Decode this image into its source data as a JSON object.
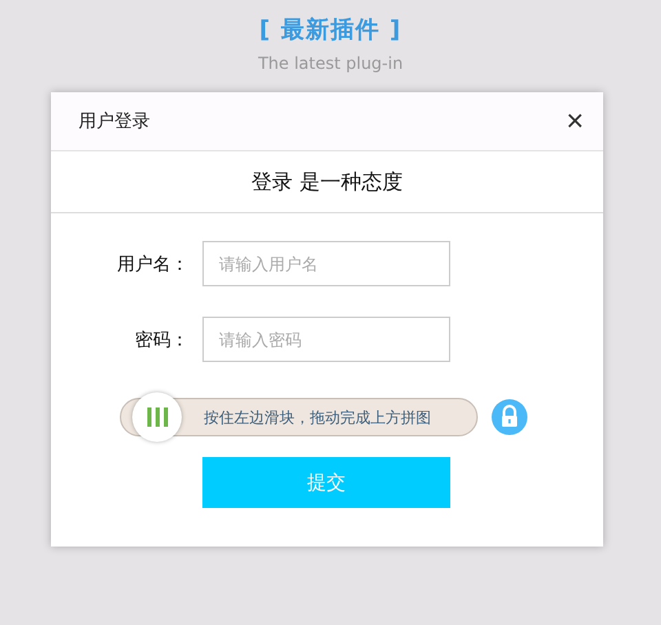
{
  "section": {
    "title": "[ 最新插件 ]",
    "subtitle": "The latest plug-in"
  },
  "dialog": {
    "title": "用户登录",
    "close": "×",
    "heading": "登录 是一种态度",
    "fields": [
      {
        "label": "用户名：",
        "placeholder": "请输入用户名"
      },
      {
        "label": "密码：",
        "placeholder": "请输入密码"
      }
    ],
    "slider": {
      "hint": "按住左边滑块，拖动完成上方拼图",
      "locked": true
    },
    "submit": "提交"
  }
}
